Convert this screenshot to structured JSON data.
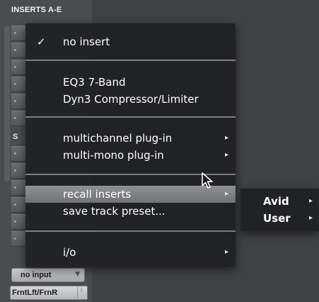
{
  "strip": {
    "header": "INSERTS A-E",
    "sends_letter": "S",
    "input_button": "no input",
    "output_button": "FrntLft/FrnR",
    "dropdown_icon": "triangle-down-icon"
  },
  "menu": {
    "items": [
      {
        "label": "no insert",
        "checked": "✓"
      },
      {
        "label": "EQ3 7-Band"
      },
      {
        "label": "Dyn3 Compressor/Limiter"
      },
      {
        "label": "multichannel plug-in",
        "arrow": "▸"
      },
      {
        "label": "multi-mono plug-in",
        "arrow": "▸"
      },
      {
        "label": "recall inserts",
        "arrow": "▸",
        "highlighted": true
      },
      {
        "label": "save track preset..."
      },
      {
        "label": "i/o",
        "arrow": "▸"
      }
    ]
  },
  "submenu": {
    "items": [
      {
        "label": "Avid",
        "arrow": "▸"
      },
      {
        "label": "User",
        "arrow": "▸"
      }
    ]
  },
  "colors": {
    "menu_bg": "#202124",
    "highlight": "#808185",
    "separator": "#7c7d81",
    "text": "#ffffff"
  }
}
